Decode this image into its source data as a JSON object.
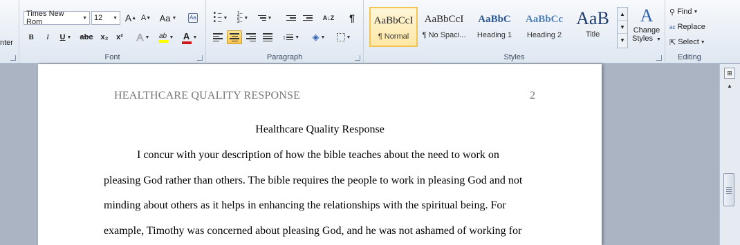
{
  "ribbon": {
    "clipboard": {
      "partial_label": "nter"
    },
    "font": {
      "label": "Font",
      "font_name": "Times New Rom",
      "font_size": "12",
      "grow_font": "A",
      "shrink_font": "A",
      "change_case": "Aa",
      "bold": "B",
      "italic": "I",
      "underline": "U",
      "strikethrough": "abc",
      "subscript": "x₂",
      "superscript": "x²",
      "text_effects": "A",
      "highlight": "ab",
      "font_color": "A",
      "font_color_hex": "#d11a1a",
      "highlight_hex": "#ffff00"
    },
    "paragraph": {
      "label": "Paragraph",
      "sort": "A↓Z",
      "show_marks": "¶"
    },
    "styles": {
      "label": "Styles",
      "items": [
        {
          "preview": "AaBbCcI",
          "name": "¶ Normal"
        },
        {
          "preview": "AaBbCcI",
          "name": "¶ No Spaci..."
        },
        {
          "preview": "AaBbC",
          "name": "Heading 1"
        },
        {
          "preview": "AaBbCc",
          "name": "Heading 2"
        },
        {
          "preview": "AaB",
          "name": "Title"
        }
      ],
      "change_styles_line1": "Change",
      "change_styles_line2": "Styles"
    },
    "editing": {
      "label": "Editing",
      "find": "Find",
      "replace": "Replace",
      "select": "Select"
    }
  },
  "document": {
    "header_title": "HEALTHCARE QUALITY RESPONSE",
    "page_number": "2",
    "title": "Healthcare Quality Response",
    "lines": [
      "I concur with your description of how the bible teaches about the need to work on",
      "pleasing God rather than others. The bible requires the people to work in pleasing God and not",
      "minding about others as it helps in enhancing the relationships with the spiritual being. For",
      "example, Timothy was concerned about pleasing God, and he was not ashamed of working for"
    ]
  }
}
